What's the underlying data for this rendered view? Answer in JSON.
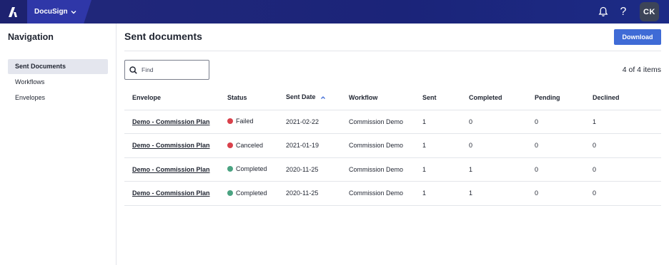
{
  "topbar": {
    "app_name": "DocuSign",
    "avatar_initials": "CK",
    "help_label": "?"
  },
  "sidebar": {
    "title": "Navigation",
    "items": [
      {
        "label": "Sent Documents",
        "active": true
      },
      {
        "label": "Workflows",
        "active": false
      },
      {
        "label": "Envelopes",
        "active": false
      }
    ]
  },
  "main": {
    "title": "Sent documents",
    "download_label": "Download",
    "search_placeholder": "Find",
    "count_text": "4 of 4 items"
  },
  "table": {
    "columns": [
      "Envelope",
      "Status",
      "Sent Date",
      "Workflow",
      "Sent",
      "Completed",
      "Pending",
      "Declined"
    ],
    "rows": [
      {
        "envelope": "Demo - Commission Plan",
        "status": "Failed",
        "sent_date": "2021-02-22",
        "workflow": "Commission Demo",
        "sent": "1",
        "completed": "0",
        "pending": "0",
        "declined": "1"
      },
      {
        "envelope": "Demo - Commission Plan",
        "status": "Canceled",
        "sent_date": "2021-01-19",
        "workflow": "Commission Demo",
        "sent": "1",
        "completed": "0",
        "pending": "0",
        "declined": "0"
      },
      {
        "envelope": "Demo - Commission Plan",
        "status": "Completed",
        "sent_date": "2020-11-25",
        "workflow": "Commission Demo",
        "sent": "1",
        "completed": "1",
        "pending": "0",
        "declined": "0"
      },
      {
        "envelope": "Demo - Commission Plan",
        "status": "Completed",
        "sent_date": "2020-11-25",
        "workflow": "Commission Demo",
        "sent": "1",
        "completed": "1",
        "pending": "0",
        "declined": "0"
      }
    ]
  },
  "colors": {
    "topbar": "#1b2479",
    "accent": "#3f6bd6",
    "status_failed": "#d9414b",
    "status_canceled": "#d9414b",
    "status_completed": "#4aa381"
  }
}
